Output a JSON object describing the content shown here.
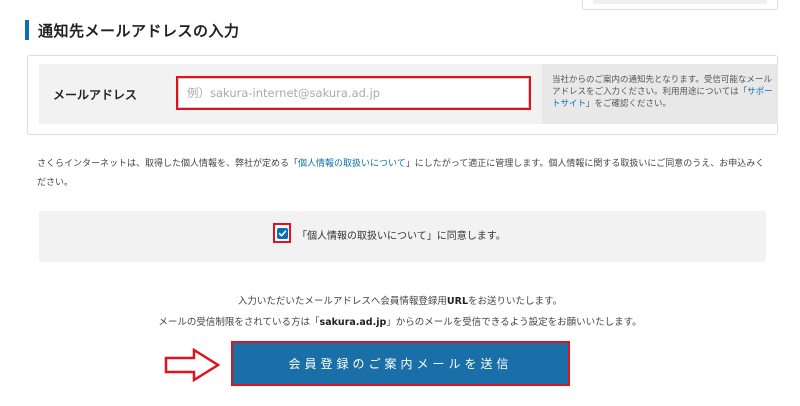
{
  "section": {
    "heading": "通知先メールアドレスの入力"
  },
  "form": {
    "email_label": "メールアドレス",
    "email_placeholder": "例）sakura-internet@sakura.ad.jp",
    "email_value": "",
    "help_text_1": "当社からのご案内の通知先となります。受信可能なメールアドレスをご入力ください。利用用途については「",
    "help_link": "サポートサイト",
    "help_text_2": "」をご確認ください。"
  },
  "privacy": {
    "text_1": "さくらインターネットは、取得した個人情報を、弊社が定める「",
    "link": "個人情報の取扱いについて",
    "text_2": "」にしたがって適正に管理します。個人情報に関する取扱いにご同意のうえ、お申込みください。"
  },
  "agreement": {
    "checked": true,
    "label": "「個人情報の取扱いについて」に同意します。"
  },
  "info": {
    "line1_prefix": "入力いただいたメールアドレスへ会員情報登録用",
    "line1_strong": "URL",
    "line1_suffix": "をお送りいたします。",
    "line2_prefix": "メールの受信制限をされている方は「",
    "line2_strong": "sakura.ad.jp",
    "line2_suffix": "」からのメールを受信できるよう設定をお願いいたします。"
  },
  "submit": {
    "label": "会員登録のご案内メールを送信"
  },
  "colors": {
    "accent": "#0a6fb5",
    "button": "#1a6fa8",
    "highlight": "#e0121e"
  },
  "icons": {
    "arrow": "arrow-right-icon",
    "check": "checkmark-icon"
  }
}
